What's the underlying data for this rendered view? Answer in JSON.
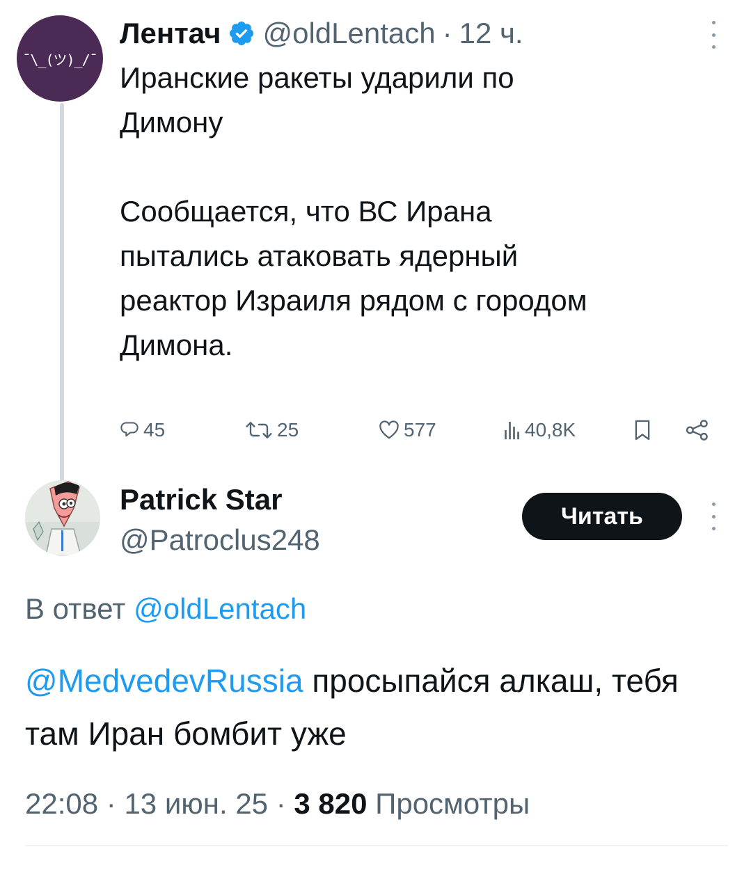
{
  "tweet": {
    "author_name": "Лентач",
    "author_handle": "@oldLentach",
    "separator": "·",
    "time_ago": "12 ч.",
    "avatar_text": "¯\\_(ツ)_/¯",
    "text": "Иранские ракеты ударили по\nДимону\n\nСообщается, что ВС Ирана\nпытались атаковать ядерный\nреактор Израиля рядом с городом\nДимона.",
    "replies": "45",
    "reposts": "25",
    "likes": "577",
    "views": "40,8K"
  },
  "reply": {
    "author_name": "Patrick Star",
    "author_handle": "@Patroclus248",
    "follow_label": "Читать",
    "reply_to_prefix": "В ответ",
    "reply_to_handle": "@oldLentach",
    "mention": "@MedvedevRussia",
    "text": " просыпайся алкаш, тебя там Иран бомбит уже",
    "time": "22:08",
    "date": "13 июн. 25",
    "views_count": "3 820",
    "views_label": "Просмотры"
  },
  "colors": {
    "link": "#1d9bf0",
    "muted": "#536471",
    "text": "#0f1419",
    "verified": "#1d9bf0",
    "avatar_bg": "#4b2a55"
  },
  "icons": {
    "verified": "verified-badge-icon",
    "more": "more-vertical-icon",
    "reply": "reply-icon",
    "repost": "repost-icon",
    "like": "heart-icon",
    "views": "views-chart-icon",
    "bookmark": "bookmark-icon",
    "share": "share-icon"
  }
}
